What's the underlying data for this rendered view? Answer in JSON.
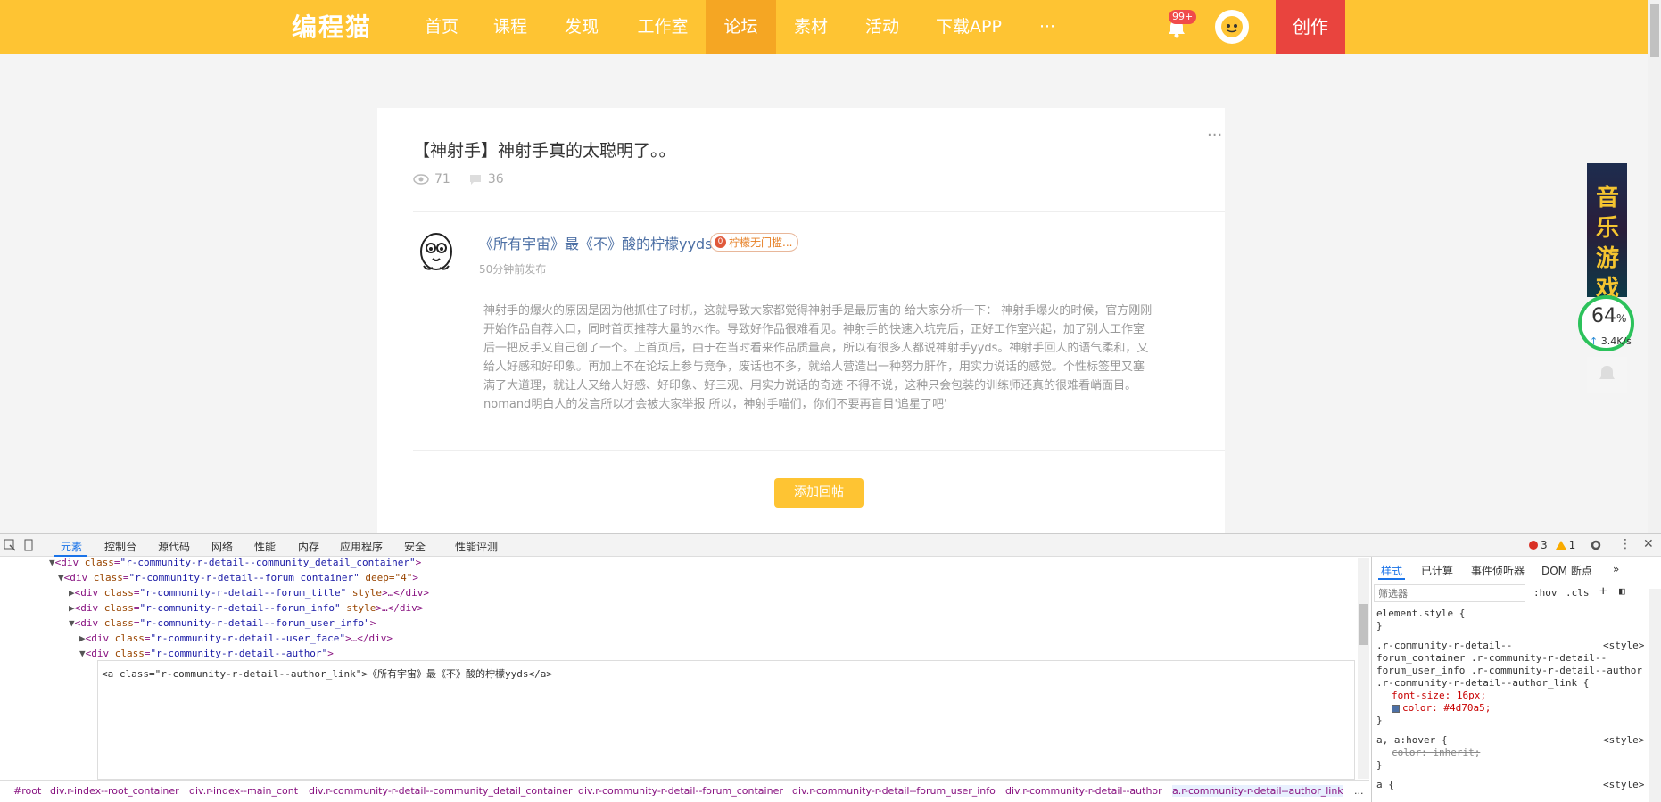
{
  "nav": {
    "logo": "编程猫",
    "items": [
      "首页",
      "课程",
      "发现",
      "工作室",
      "论坛",
      "素材",
      "活动",
      "下载APP",
      "···"
    ],
    "active_index": 4,
    "notif_badge": "99+",
    "create_label": "创作"
  },
  "post": {
    "title": "【神射手】神射手真的太聪明了。。",
    "more": "···",
    "views": "71",
    "comments": "36",
    "author": "《所有宇宙》最《不》酸的柠檬yyds",
    "badge_num": "0",
    "badge_label": "柠檬无门槛...",
    "time": "50分钟前发布",
    "body": "神射手的爆火的原因是因为他抓住了时机，这就导致大家都觉得神射手是最厉害的 给大家分析一下： 神射手爆火的时候，官方刚刚开始作品自荐入口，同时首页推荐大量的水作。导致好作品很难看见。神射手的快速入坑完后，正好工作室兴起，加了别人工作室后一把反手又自己创了一个。上首页后，由于在当时看来作品质量高，所以有很多人都说神射手yyds。神射手回人的语气柔和，又给人好感和好印象。再加上不在论坛上参与竞争，废话也不多，就给人营造出一种努力肝作，用实力说话的感觉。个性标签里又塞满了大道理，就让人又给人好感、好印象、好三观、用实力说话的奇迹 不得不说，这种只会包装的训练师还真的很难看峭面目。nomand明白人的发言所以才会被大家举报 所以，神射手喵们，你们不要再盲目'追星了吧'",
    "reply_label": "添加回帖"
  },
  "side": {
    "ad_text": "音乐游戏",
    "speed_pct": "64",
    "speed_pct_unit": "%",
    "speed_rate": "3.4K/s"
  },
  "devtools": {
    "tabs": [
      "元素",
      "控制台",
      "源代码",
      "网络",
      "性能",
      "内存",
      "应用程序",
      "安全",
      "性能评测"
    ],
    "errors": "3",
    "warnings": "1",
    "dom_lines": [
      {
        "tag": "div",
        "cls": "r-community-r-detail--community_detail_container",
        "extra": "",
        "tail": ">"
      },
      {
        "tag": "div",
        "cls": "r-community-r-detail--forum_container",
        "extra": " deep=\"4\"",
        "tail": ">"
      },
      {
        "tag": "div",
        "cls": "r-community-r-detail--forum_title",
        "extra": " style",
        "tail": ">…</div>"
      },
      {
        "tag": "div",
        "cls": "r-community-r-detail--forum_info",
        "extra": " style",
        "tail": ">…</div>"
      },
      {
        "tag": "div",
        "cls": "r-community-r-detail--forum_user_info",
        "extra": "",
        "tail": ">"
      },
      {
        "tag": "div",
        "cls": "r-community-r-detail--user_face",
        "extra": "",
        "tail": ">…</div>"
      },
      {
        "tag": "div",
        "cls": "r-community-r-detail--author",
        "extra": "",
        "tail": ">"
      }
    ],
    "edit_text": "<a class=\"r-community-r-detail--author_link\">《所有宇宙》最《不》酸的柠檬yyds</a>",
    "breadcrumbs": [
      "#root",
      "div.r-index--root_container",
      "div.r-index--main_cont",
      "div.r-community-r-detail--community_detail_container",
      "div.r-community-r-detail--forum_container",
      "div.r-community-r-detail--forum_user_info",
      "div.r-community-r-detail--author",
      "a.r-community-r-detail--author_link",
      "..."
    ],
    "style_tabs": [
      "样式",
      "已计算",
      "事件侦听器",
      "DOM 断点",
      "»"
    ],
    "filter_placeholder": "筛选器",
    "hov": ":hov",
    "cls": ".cls",
    "rules": {
      "element_style": "element.style {",
      "selector1": ".r-community-r-detail--",
      "selector2": "forum_container .r-community-r-detail--",
      "selector3": "forum_user_info .r-community-r-detail--author",
      "selector4": ".r-community-r-detail--author_link {",
      "source": "<style>",
      "font_size": "font-size: 16px;",
      "color": "color: #4d70a5;",
      "a_hover": "a, a:hover {",
      "color_inherit": "color: inherit;",
      "a_rule": "a {"
    }
  }
}
